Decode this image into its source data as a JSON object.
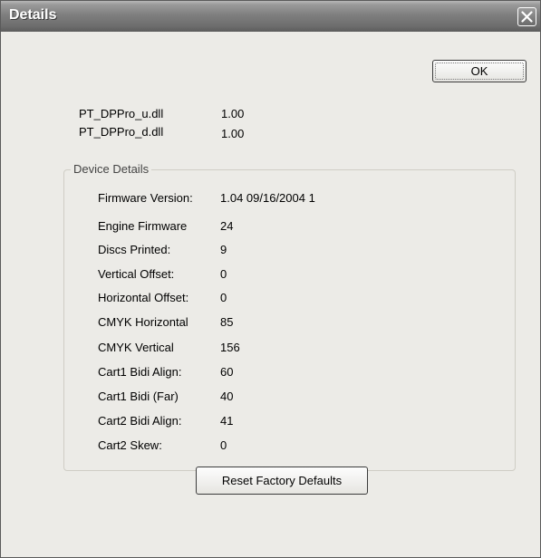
{
  "window": {
    "title": "Details"
  },
  "buttons": {
    "ok": "OK",
    "reset": "Reset Factory Defaults"
  },
  "dlls": [
    {
      "name": "PT_DPPro_u.dll",
      "version": "1.00"
    },
    {
      "name": "PT_DPPro_d.dll",
      "version": "1.00"
    }
  ],
  "device_details": {
    "group_title": "Device Details",
    "rows": [
      {
        "label": "Firmware Version:",
        "value": "1.04 09/16/2004   1"
      },
      {
        "label": "Engine Firmware",
        "value": "24"
      },
      {
        "label": "Discs Printed:",
        "value": "9"
      },
      {
        "label": "Vertical Offset:",
        "value": "0"
      },
      {
        "label": "Horizontal Offset:",
        "value": "0"
      },
      {
        "label": "CMYK Horizontal",
        "value": "85"
      },
      {
        "label": "CMYK Vertical",
        "value": "156"
      },
      {
        "label": "Cart1 Bidi Align:",
        "value": "60"
      },
      {
        "label": "Cart1 Bidi (Far)",
        "value": "40"
      },
      {
        "label": "Cart2 Bidi Align:",
        "value": "41"
      },
      {
        "label": "Cart2 Skew:",
        "value": "0"
      }
    ]
  }
}
